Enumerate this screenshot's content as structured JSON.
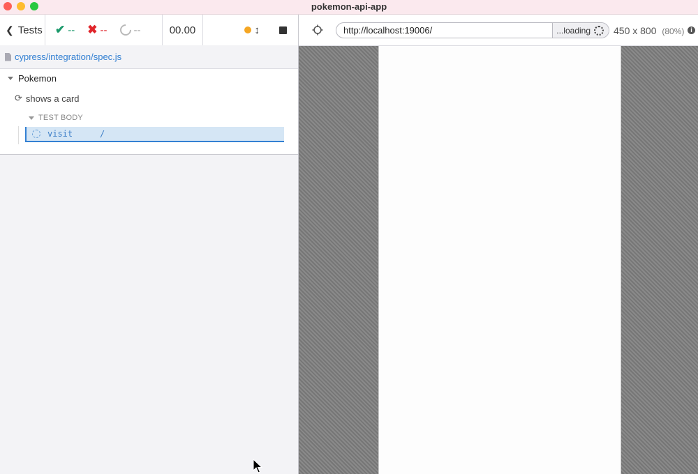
{
  "window": {
    "title": "pokemon-api-app"
  },
  "reporter": {
    "back_label": "Tests",
    "stats": {
      "passed": "--",
      "failed": "--",
      "pending": "--"
    },
    "duration": "00.00",
    "spec_path": "cypress/integration/spec.js",
    "suite": {
      "title": "Pokemon",
      "test": {
        "title": "shows a card",
        "section": "TEST BODY",
        "command": {
          "name": "visit",
          "message": "/"
        }
      }
    }
  },
  "aut": {
    "url": "http://localhost:19006/",
    "loading_label": "...loading",
    "viewport_size": "450 x 800",
    "viewport_scale": "(80%)",
    "info_icon": "i"
  },
  "colors": {
    "pass": "#1d9a6c",
    "fail": "#e0252b",
    "accent": "#3380d3",
    "running": "#f5a623"
  }
}
